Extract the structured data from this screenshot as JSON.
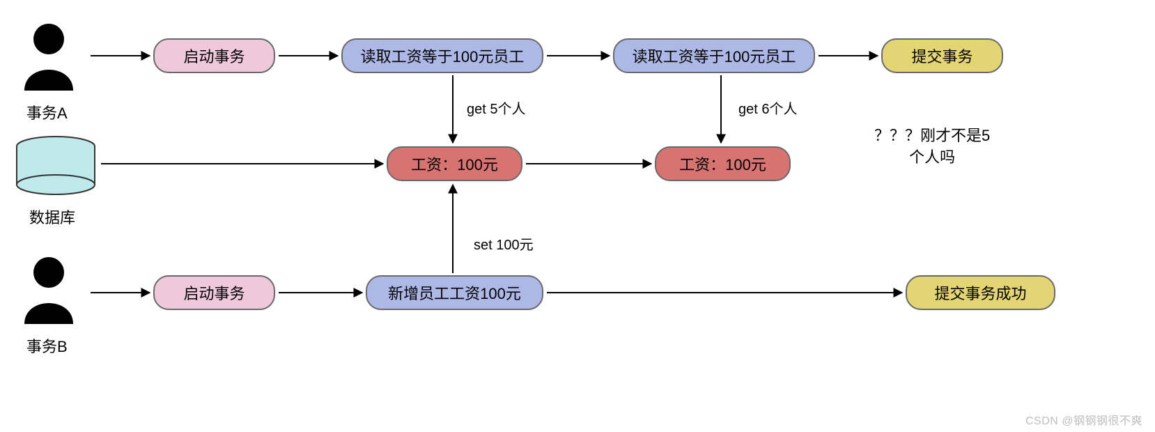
{
  "actors": {
    "transaction_a": "事务A",
    "database": "数据库",
    "transaction_b": "事务B"
  },
  "row_a": {
    "start": "启动事务",
    "read1": "读取工资等于100元员工",
    "read2": "读取工资等于100元员工",
    "commit": "提交事务"
  },
  "row_db": {
    "salary1": "工资：100元",
    "salary2": "工资：100元"
  },
  "row_b": {
    "start": "启动事务",
    "insert": "新增员工工资100元",
    "commit": "提交事务成功"
  },
  "edge_labels": {
    "get5": "get 5个人",
    "get6": "get 6个人",
    "set100": "set 100元"
  },
  "comment": {
    "line1": "？？？刚才不是5",
    "line2": "个人吗"
  },
  "watermark": "CSDN @钢钢钢很不爽"
}
